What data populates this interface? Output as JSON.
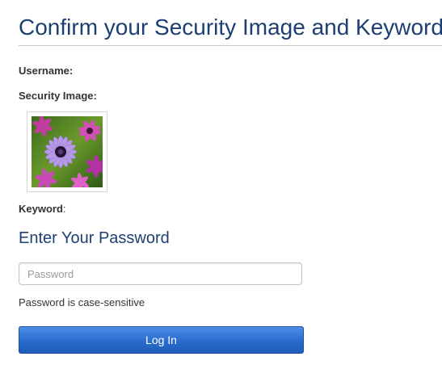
{
  "header": {
    "title": "Confirm your Security Image and Keyword"
  },
  "fields": {
    "username_label": "Username:",
    "security_image_label": "Security Image:",
    "keyword_label": "Keyword",
    "keyword_suffix": ":"
  },
  "password_section": {
    "title": "Enter Your Password",
    "placeholder": "Password",
    "value": "",
    "hint": "Password is case-sensitive",
    "login_label": "Log In"
  },
  "colors": {
    "heading": "#1d3f72",
    "button": "#2a6bcd"
  }
}
